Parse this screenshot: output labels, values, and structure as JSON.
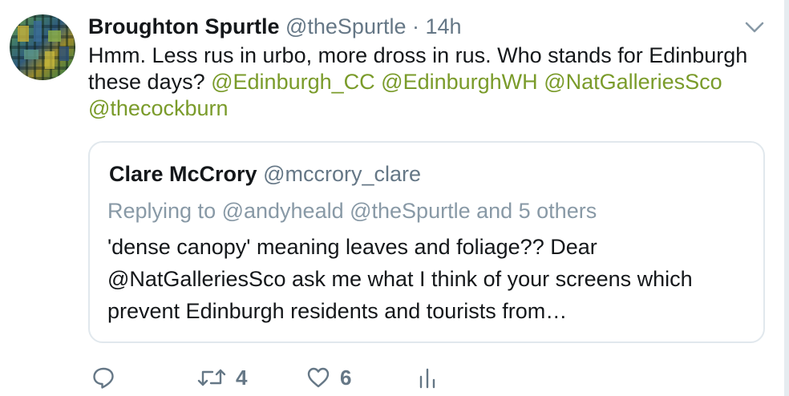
{
  "tweet": {
    "author_name": "Broughton Spurtle",
    "author_handle": "@theSpurtle",
    "separator": "·",
    "time": "14h",
    "text_plain_1": "Hmm. Less rus in urbo, more dross in rus. Who stands for Edinburgh these days?",
    "mentions": [
      "@Edinburgh_CC",
      "@EdinburghWH",
      "@NatGalleriesSco",
      "@thecockburn"
    ],
    "menu_icon": "chevron-down-icon"
  },
  "quoted": {
    "author_name": "Clare McCrory",
    "author_handle": "@mccrory_clare",
    "replying_to": "Replying to @andyheald @theSpurtle and 5 others",
    "text": "'dense canopy' meaning leaves and foliage?? Dear @NatGalleriesSco ask me what I think of your screens which prevent Edinburgh residents and tourists from…"
  },
  "actions": {
    "reply_icon": "reply-icon",
    "retweet_icon": "retweet-icon",
    "retweet_count": "4",
    "like_icon": "heart-icon",
    "like_count": "6",
    "analytics_icon": "analytics-icon"
  },
  "colors": {
    "mention": "#7a9b2a",
    "secondary_text": "#657786",
    "border": "#e1e8ed"
  }
}
